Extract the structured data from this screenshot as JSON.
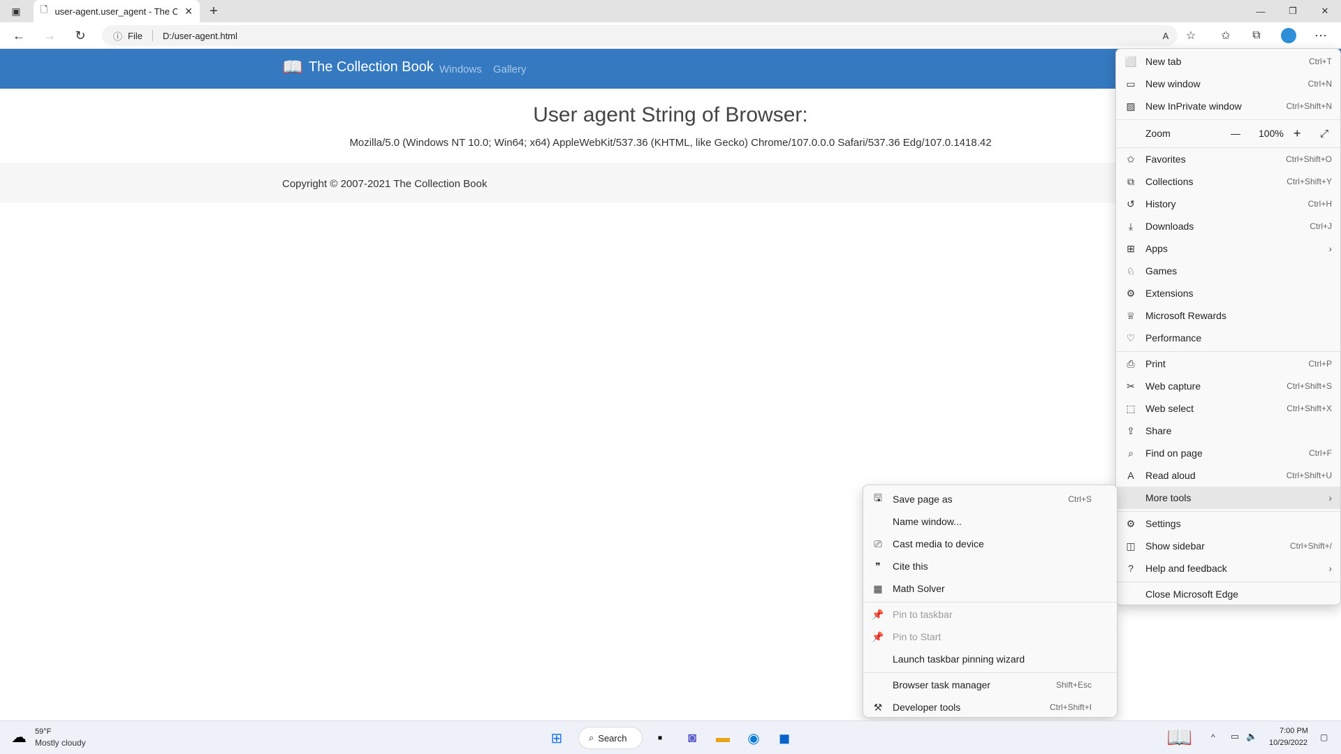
{
  "browser": {
    "tab_title": "user-agent.user_agent - The Coll",
    "address_protocol": "File",
    "address_url": "D:/user-agent.html"
  },
  "site": {
    "brand": "The Collection Book",
    "nav": [
      "Windows",
      "Gallery"
    ],
    "heading": "User agent String of Browser:",
    "user_agent": "Mozilla/5.0 (Windows NT 10.0; Win64; x64) AppleWebKit/537.36 (KHTML, like Gecko) Chrome/107.0.0.0 Safari/537.36 Edg/107.0.1418.42",
    "footer": "Copyright © 2007-2021 The Collection Book"
  },
  "main_menu": {
    "new_tab": {
      "label": "New tab",
      "shortcut": "Ctrl+T"
    },
    "new_window": {
      "label": "New window",
      "shortcut": "Ctrl+N"
    },
    "new_private": {
      "label": "New InPrivate window",
      "shortcut": "Ctrl+Shift+N"
    },
    "zoom": {
      "label": "Zoom",
      "minus": "—",
      "value": "100%",
      "plus": "+"
    },
    "favorites": {
      "label": "Favorites",
      "shortcut": "Ctrl+Shift+O"
    },
    "collections": {
      "label": "Collections",
      "shortcut": "Ctrl+Shift+Y"
    },
    "history": {
      "label": "History",
      "shortcut": "Ctrl+H"
    },
    "downloads": {
      "label": "Downloads",
      "shortcut": "Ctrl+J"
    },
    "apps": {
      "label": "Apps"
    },
    "games": {
      "label": "Games"
    },
    "extensions": {
      "label": "Extensions"
    },
    "rewards": {
      "label": "Microsoft Rewards"
    },
    "performance": {
      "label": "Performance"
    },
    "print": {
      "label": "Print",
      "shortcut": "Ctrl+P"
    },
    "web_capture": {
      "label": "Web capture",
      "shortcut": "Ctrl+Shift+S"
    },
    "web_select": {
      "label": "Web select",
      "shortcut": "Ctrl+Shift+X"
    },
    "share": {
      "label": "Share"
    },
    "find": {
      "label": "Find on page",
      "shortcut": "Ctrl+F"
    },
    "read_aloud": {
      "label": "Read aloud",
      "shortcut": "Ctrl+Shift+U"
    },
    "more_tools": {
      "label": "More tools"
    },
    "settings": {
      "label": "Settings"
    },
    "show_sidebar": {
      "label": "Show sidebar",
      "shortcut": "Ctrl+Shift+/"
    },
    "help": {
      "label": "Help and feedback"
    },
    "close": {
      "label": "Close Microsoft Edge"
    }
  },
  "more_tools_menu": {
    "save_page": {
      "label": "Save page as",
      "shortcut": "Ctrl+S"
    },
    "name_window": {
      "label": "Name window..."
    },
    "cast": {
      "label": "Cast media to device"
    },
    "cite": {
      "label": "Cite this"
    },
    "math": {
      "label": "Math Solver"
    },
    "pin_taskbar": {
      "label": "Pin to taskbar"
    },
    "pin_start": {
      "label": "Pin to Start"
    },
    "launch_wizard": {
      "label": "Launch taskbar pinning wizard"
    },
    "task_manager": {
      "label": "Browser task manager",
      "shortcut": "Shift+Esc"
    },
    "dev_tools": {
      "label": "Developer tools",
      "shortcut": "Ctrl+Shift+I"
    }
  },
  "taskbar": {
    "weather_temp": "59°F",
    "weather_desc": "Mostly cloudy",
    "search_label": "Search",
    "time": "7:00 PM",
    "date": "10/29/2022"
  },
  "colors": {
    "site_header": "#3579c0",
    "menu_bg": "#f9f9f9",
    "highlight": "#e6e6e6"
  }
}
